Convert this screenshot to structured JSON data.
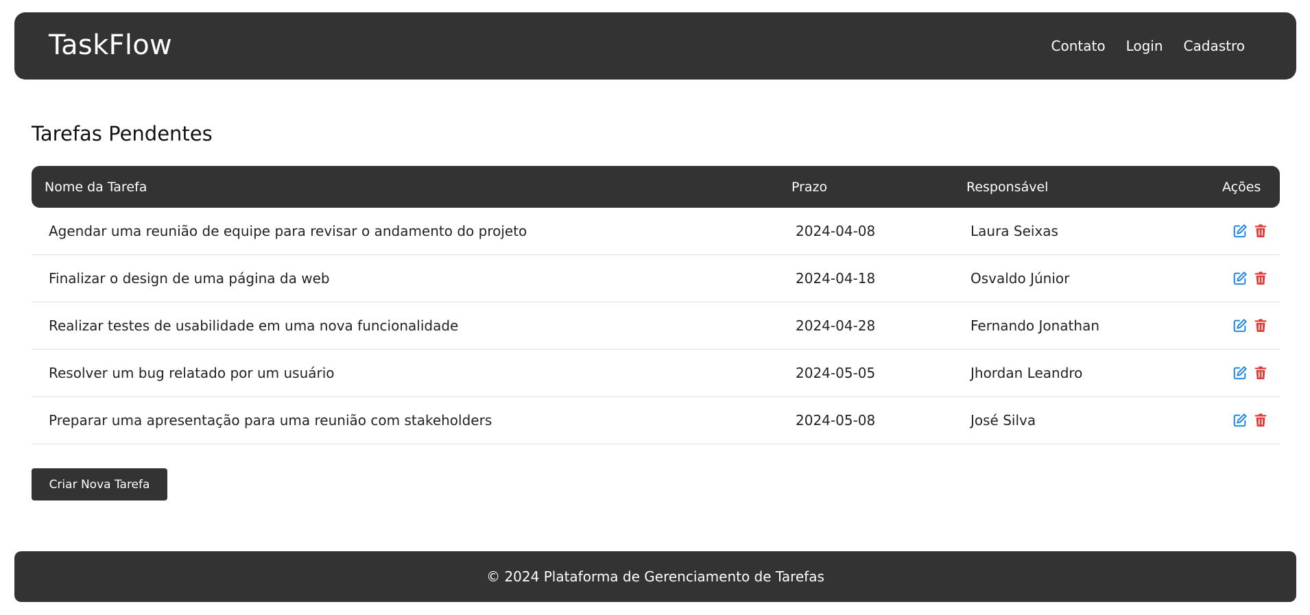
{
  "header": {
    "brand": "TaskFlow",
    "nav": [
      {
        "label": "Contato"
      },
      {
        "label": "Login"
      },
      {
        "label": "Cadastro"
      }
    ]
  },
  "main": {
    "title": "Tarefas Pendentes",
    "table": {
      "columns": [
        "Nome da Tarefa",
        "Prazo",
        "Responsável",
        "Ações"
      ],
      "rows": [
        {
          "name": "Agendar uma reunião de equipe para revisar o andamento do projeto",
          "prazo": "2024-04-08",
          "responsavel": "Laura Seixas"
        },
        {
          "name": "Finalizar o design de uma página da web",
          "prazo": "2024-04-18",
          "responsavel": "Osvaldo Júnior"
        },
        {
          "name": "Realizar testes de usabilidade em uma nova funcionalidade",
          "prazo": "2024-04-28",
          "responsavel": "Fernando Jonathan"
        },
        {
          "name": "Resolver um bug relatado por um usuário",
          "prazo": "2024-05-05",
          "responsavel": "Jhordan Leandro"
        },
        {
          "name": "Preparar uma apresentação para uma reunião com stakeholders",
          "prazo": "2024-05-08",
          "responsavel": "José Silva"
        }
      ],
      "action_icons": {
        "edit": "edit-icon",
        "delete": "trash-icon"
      }
    },
    "create_button": "Criar Nova Tarefa"
  },
  "footer": {
    "text": "© 2024 Plataforma de Gerenciamento de Tarefas"
  },
  "colors": {
    "dark": "#333333",
    "edit_icon": "#1e88e5",
    "delete_icon": "#e53935"
  }
}
